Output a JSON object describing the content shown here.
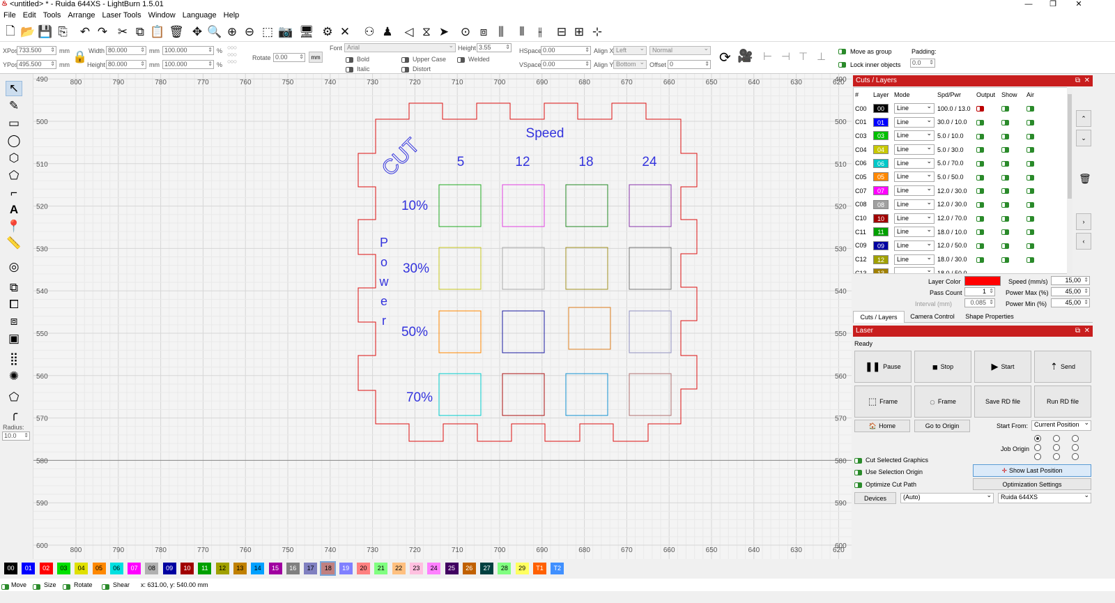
{
  "window": {
    "title": "<untitled> * - Ruida 644XS - LightBurn 1.5.01"
  },
  "menu": [
    "File",
    "Edit",
    "Tools",
    "Arrange",
    "Laser Tools",
    "Window",
    "Language",
    "Help"
  ],
  "props": {
    "xpos_label": "XPos",
    "xpos": "733.500",
    "ypos_label": "YPos",
    "ypos": "495.500",
    "unit": "mm",
    "width_label": "Width",
    "width": "80.000",
    "height_label": "Height",
    "height": "80.000",
    "wpct": "100.000",
    "hpct": "100.000",
    "pct": "%",
    "rotate_label": "Rotate",
    "rotate": "0.00",
    "mm_btn": "mm",
    "font_label": "Font",
    "font": "Arial",
    "fheight_label": "Height",
    "fheight": "3.55",
    "hspace_label": "HSpace",
    "hspace": "0.00",
    "vspace_label": "VSpace",
    "vspace": "0.00",
    "alignx_label": "Align X",
    "alignx": "Left",
    "aligny_label": "Align Y",
    "aligny": "Bottom",
    "normal": "Normal",
    "offset_label": "Offset",
    "offset": "0",
    "bold": "Bold",
    "italic": "Italic",
    "upper": "Upper Case",
    "distort": "Distort",
    "welded": "Welded",
    "move_group": "Move as group",
    "lock_inner": "Lock inner objects",
    "padding_label": "Padding:",
    "padding": "0.0"
  },
  "ruler": {
    "top": [
      "800",
      "790",
      "780",
      "770",
      "760",
      "750",
      "740",
      "730",
      "720",
      "710",
      "700",
      "690",
      "680",
      "670",
      "660",
      "650",
      "640",
      "630",
      "620"
    ],
    "left": [
      "490",
      "500",
      "510",
      "520",
      "530",
      "540",
      "550",
      "560",
      "570",
      "580",
      "590",
      "600"
    ]
  },
  "design": {
    "cut_text": "CUT",
    "speed_label": "Speed",
    "speeds": [
      "5",
      "12",
      "18",
      "24"
    ],
    "powers": [
      "10%",
      "30%",
      "50%",
      "70%"
    ],
    "power_letters": [
      "P",
      "o",
      "w",
      "e",
      "r"
    ],
    "grid_colors": [
      [
        "#22aa22",
        "#e040e0",
        "#228822",
        "#8833aa"
      ],
      [
        "#c8c820",
        "#aaaaaa",
        "#a09020",
        "#777777"
      ],
      [
        "#ff8800",
        "#1a1aa0",
        "#e08020",
        "#9090c0"
      ],
      [
        "#00cccc",
        "#aa1111",
        "#1090d0",
        "#b07070"
      ]
    ]
  },
  "cuts": {
    "title": "Cuts / Layers",
    "headers": [
      "#",
      "Layer",
      "Mode",
      "Spd/Pwr",
      "Output",
      "Show",
      "Air"
    ],
    "rows": [
      {
        "id": "C00",
        "layer": "00",
        "color": "#000000",
        "mode": "Line",
        "sp": "100.0 / 13.0",
        "out": "red"
      },
      {
        "id": "C01",
        "layer": "01",
        "color": "#0000ff",
        "mode": "Line",
        "sp": "30.0 / 10.0",
        "out": "on"
      },
      {
        "id": "C03",
        "layer": "03",
        "color": "#00c000",
        "mode": "Line",
        "sp": "5.0 / 10.0",
        "out": "on"
      },
      {
        "id": "C04",
        "layer": "04",
        "color": "#c8c800",
        "mode": "Line",
        "sp": "5.0 / 30.0",
        "out": "on"
      },
      {
        "id": "C06",
        "layer": "06",
        "color": "#00c8c8",
        "mode": "Line",
        "sp": "5.0 / 70.0",
        "out": "on"
      },
      {
        "id": "C05",
        "layer": "05",
        "color": "#ff8800",
        "mode": "Line",
        "sp": "5.0 / 50.0",
        "out": "on"
      },
      {
        "id": "C07",
        "layer": "07",
        "color": "#ff00ff",
        "mode": "Line",
        "sp": "12.0 / 30.0",
        "out": "on"
      },
      {
        "id": "C08",
        "layer": "08",
        "color": "#a0a0a0",
        "mode": "Line",
        "sp": "12.0 / 30.0",
        "out": "on"
      },
      {
        "id": "C10",
        "layer": "10",
        "color": "#a00000",
        "mode": "Line",
        "sp": "12.0 / 70.0",
        "out": "on"
      },
      {
        "id": "C11",
        "layer": "11",
        "color": "#00a000",
        "mode": "Line",
        "sp": "18.0 / 10.0",
        "out": "on"
      },
      {
        "id": "C09",
        "layer": "09",
        "color": "#0000a0",
        "mode": "Line",
        "sp": "12.0 / 50.0",
        "out": "on"
      },
      {
        "id": "C12",
        "layer": "12",
        "color": "#a0a000",
        "mode": "Line",
        "sp": "18.0 / 30.0",
        "out": "on"
      }
    ],
    "partial": {
      "id": "C13",
      "layer": "13",
      "color": "#a08000",
      "sp": "18.0 / 50.0"
    },
    "layer_color_label": "Layer Color",
    "layer_color": "#ff0000",
    "pass_label": "Pass Count",
    "pass": "1",
    "interval_label": "Interval (mm)",
    "interval": "0.085",
    "speed_label": "Speed (mm/s)",
    "speed": "15,00",
    "pmax_label": "Power Max (%)",
    "pmax": "45,00",
    "pmin_label": "Power Min (%)",
    "pmin": "45,00",
    "tabs": [
      "Cuts / Layers",
      "Camera Control",
      "Shape Properties"
    ]
  },
  "laser": {
    "title": "Laser",
    "status": "Ready",
    "pause": "Pause",
    "stop": "Stop",
    "start": "Start",
    "send": "Send",
    "frame1": "Frame",
    "frame2": "Frame",
    "save_rd": "Save RD file",
    "run_rd": "Run RD file",
    "home": "Home",
    "goto_origin": "Go to Origin",
    "start_from_label": "Start From:",
    "start_from": "Current Position",
    "job_origin": "Job Origin",
    "cut_selected": "Cut Selected Graphics",
    "use_sel_origin": "Use Selection Origin",
    "optimize": "Optimize Cut Path",
    "show_last": "Show Last Position",
    "opt_settings": "Optimization Settings",
    "devices": "Devices",
    "auto": "(Auto)",
    "device": "Ruida 644XS"
  },
  "palette": [
    {
      "l": "00",
      "c": "#000000",
      "f": "#ffffff"
    },
    {
      "l": "01",
      "c": "#0000ff",
      "f": "#ffffff"
    },
    {
      "l": "02",
      "c": "#ff0000",
      "f": "#ffffff"
    },
    {
      "l": "03",
      "c": "#00e000",
      "f": "#000000"
    },
    {
      "l": "04",
      "c": "#e0e000",
      "f": "#000000"
    },
    {
      "l": "05",
      "c": "#ff8800",
      "f": "#000000"
    },
    {
      "l": "06",
      "c": "#00e0e0",
      "f": "#000000"
    },
    {
      "l": "07",
      "c": "#ff00ff",
      "f": "#ffffff"
    },
    {
      "l": "08",
      "c": "#b0b0b0",
      "f": "#000000"
    },
    {
      "l": "09",
      "c": "#0000a0",
      "f": "#ffffff"
    },
    {
      "l": "10",
      "c": "#a00000",
      "f": "#ffffff"
    },
    {
      "l": "11",
      "c": "#00a000",
      "f": "#ffffff"
    },
    {
      "l": "12",
      "c": "#a0a000",
      "f": "#000000"
    },
    {
      "l": "13",
      "c": "#c08000",
      "f": "#000000"
    },
    {
      "l": "14",
      "c": "#00a0ff",
      "f": "#000000"
    },
    {
      "l": "15",
      "c": "#a000a0",
      "f": "#ffffff"
    },
    {
      "l": "16",
      "c": "#808080",
      "f": "#ffffff"
    },
    {
      "l": "17",
      "c": "#8080c0",
      "f": "#000000"
    },
    {
      "l": "18",
      "c": "#c08080",
      "f": "#000000"
    },
    {
      "l": "19",
      "c": "#8080ff",
      "f": "#ffffff"
    },
    {
      "l": "20",
      "c": "#ff8080",
      "f": "#000000"
    },
    {
      "l": "21",
      "c": "#80ff80",
      "f": "#000000"
    },
    {
      "l": "22",
      "c": "#ffc080",
      "f": "#000000"
    },
    {
      "l": "23",
      "c": "#ffc0e0",
      "f": "#000000"
    },
    {
      "l": "24",
      "c": "#ff80ff",
      "f": "#000000"
    },
    {
      "l": "25",
      "c": "#400060",
      "f": "#ffffff"
    },
    {
      "l": "26",
      "c": "#c06000",
      "f": "#ffffff"
    },
    {
      "l": "27",
      "c": "#004040",
      "f": "#ffffff"
    },
    {
      "l": "28",
      "c": "#80ff80",
      "f": "#000000"
    },
    {
      "l": "29",
      "c": "#ffff60",
      "f": "#000000"
    },
    {
      "l": "T1",
      "c": "#ff6000",
      "f": "#ffffff"
    },
    {
      "l": "T2",
      "c": "#4090ff",
      "f": "#ffffff"
    }
  ],
  "status": {
    "move": "Move",
    "size": "Size",
    "rotate": "Rotate",
    "shear": "Shear",
    "coords": "x: 631.00, y: 540.00 mm"
  },
  "radius": {
    "label": "Radius:",
    "value": "10.0"
  }
}
